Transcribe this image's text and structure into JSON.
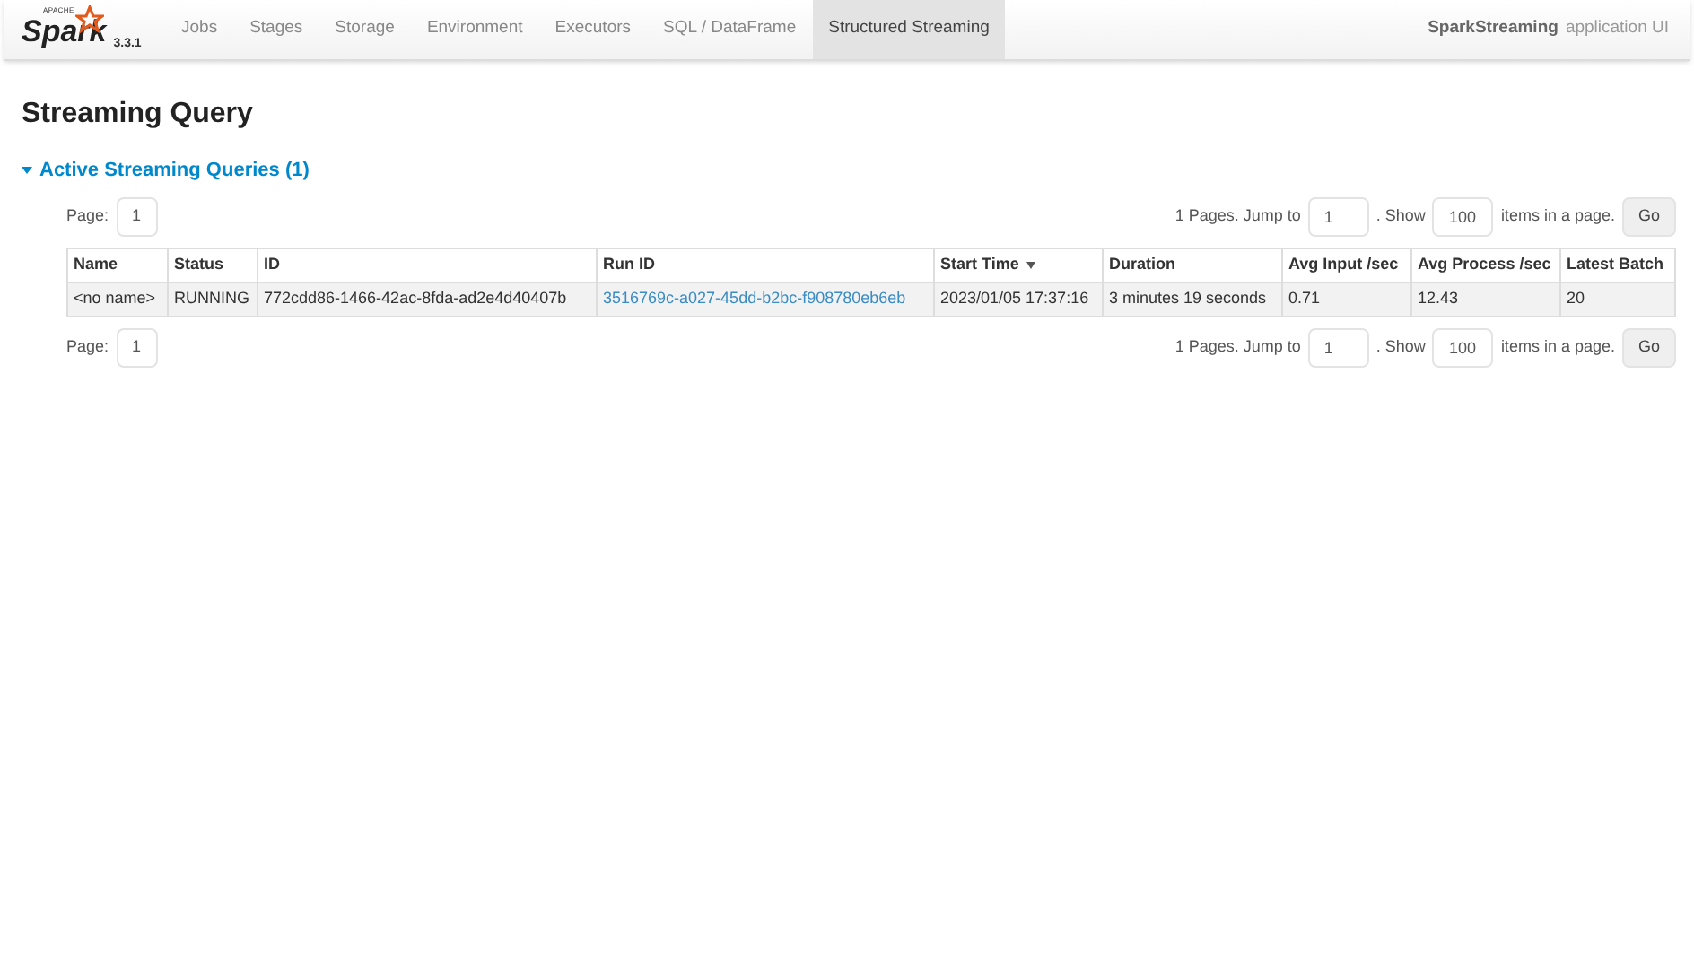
{
  "navbar": {
    "logo": {
      "brand": "Spark",
      "small_caption": "APACHE",
      "version": "3.3.1"
    },
    "tabs": [
      {
        "label": "Jobs",
        "selected": false
      },
      {
        "label": "Stages",
        "selected": false
      },
      {
        "label": "Storage",
        "selected": false
      },
      {
        "label": "Environment",
        "selected": false
      },
      {
        "label": "Executors",
        "selected": false
      },
      {
        "label": "SQL / DataFrame",
        "selected": false
      },
      {
        "label": "Structured Streaming",
        "selected": true
      }
    ],
    "app_name": "SparkStreaming",
    "app_suffix": "application UI"
  },
  "page_title": "Streaming Query",
  "section": {
    "title": "Active Streaming Queries (1)",
    "expanded": true
  },
  "pagination": [
    {
      "page_label": "Page:",
      "page": "1",
      "pages_text": "1 Pages. Jump to",
      "jump": "1",
      "show_label": ". Show",
      "show": "100",
      "items_label": "items in a page.",
      "go": "Go"
    },
    {
      "page_label": "Page:",
      "page": "1",
      "pages_text": "1 Pages. Jump to",
      "jump": "1",
      "show_label": ". Show",
      "show": "100",
      "items_label": "items in a page.",
      "go": "Go"
    }
  ],
  "table": {
    "columns": [
      {
        "label": "Name",
        "sorted": false
      },
      {
        "label": "Status",
        "sorted": false
      },
      {
        "label": "ID",
        "sorted": false
      },
      {
        "label": "Run ID",
        "sorted": false
      },
      {
        "label": "Start Time",
        "sorted": true
      },
      {
        "label": "Duration",
        "sorted": false
      },
      {
        "label": "Avg Input /sec",
        "sorted": false
      },
      {
        "label": "Avg Process /sec",
        "sorted": false
      },
      {
        "label": "Latest Batch",
        "sorted": false
      }
    ],
    "rows": [
      {
        "cells": [
          {
            "text": "<no name>",
            "kind": "text"
          },
          {
            "text": "RUNNING",
            "kind": "text"
          },
          {
            "text": "772cdd86-1466-42ac-8fda-ad2e4d40407b",
            "kind": "text"
          },
          {
            "text": "3516769c-a027-45dd-b2bc-f908780eb6eb",
            "kind": "link"
          },
          {
            "text": "2023/01/05 17:37:16",
            "kind": "text"
          },
          {
            "text": "3 minutes 19 seconds",
            "kind": "text"
          },
          {
            "text": "0.71",
            "kind": "text"
          },
          {
            "text": "12.43",
            "kind": "text"
          },
          {
            "text": "20",
            "kind": "text"
          }
        ]
      }
    ]
  }
}
